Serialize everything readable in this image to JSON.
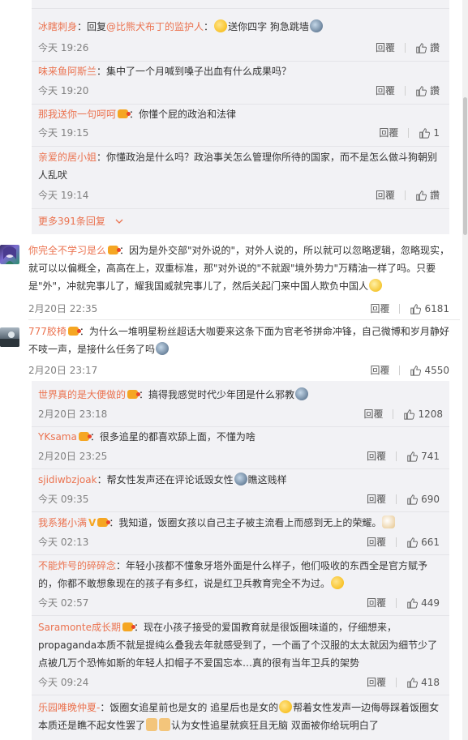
{
  "nested_group_1": {
    "replies": [
      {
        "user": "冰瞎刺身",
        "text_prefix": "：回复",
        "mention": "@比熊犬布丁的监护人",
        "text_after": "：",
        "text_rest": "送你四字 狗急跳墙",
        "time": "今天 19:26",
        "reply_label": "回覆",
        "like_label": "讚"
      },
      {
        "user": "味来鱼阿斯兰",
        "text": "：集中了一个月喊到嗓子出血有什么成果吗？",
        "time": "今天 19:20",
        "reply_label": "回覆",
        "like_label": "讚"
      },
      {
        "user": "那我送你一句呵呵",
        "text": "：你懂个屁的政治和法律",
        "time": "今天 19:15",
        "reply_label": "回覆",
        "like_count": "1"
      },
      {
        "user": "亲爱的居小姐",
        "text_line1": "：你懂政治是什么吗？政治事关怎么管理你所待的国家，而不是怎么做斗狗朝别",
        "text_line2": "人乱吠",
        "time": "今天 19:14",
        "reply_label": "回覆",
        "like_label": "讚"
      }
    ],
    "more_label": "更多391条回复",
    "more_icon": "chevron-down-icon"
  },
  "comments": [
    {
      "user": "你完全不学习是么",
      "line1": "：因为是外交部\"对外说的\"，对外人说的，所以就可以忽略逻辑，忽略现实，",
      "line2": "就可以以偏概全，高高在上，双重标准，那\"对外说的\"不就跟\"境外势力\"万精油一样了吗。只要",
      "line3": "是\"外\"，冲就完事儿了，耀我国威就完事儿了，然后关起门来中国人欺负中国人",
      "time": "2月20日 22:35",
      "reply_label": "回覆",
      "like_count": "6181"
    },
    {
      "user": "777胶椅",
      "line1": "：为什么一堆明星粉丝超话大咖要来这条下面为官老爷拼命冲锋，自己微博和岁月静好",
      "line2": "不吱一声，是接什么任务了吗",
      "time": "2月20日 23:17",
      "reply_label": "回覆",
      "like_count": "4550"
    }
  ],
  "nested_group_2": {
    "replies": [
      {
        "user": "世界真的是大便做的",
        "text": "：搞得我感觉时代少年团是什么邪教",
        "time": "2月20日 23:18",
        "reply_label": "回覆",
        "like_count": "1208"
      },
      {
        "user": "YKsama",
        "text": "：很多追星的都喜欢舔上面，不懂为啥",
        "time": "2月20日 23:25",
        "reply_label": "回覆",
        "like_count": "741"
      },
      {
        "user": "sjidiwbzjoak",
        "text_a": "：帮女性发声还在评论诋毁女性",
        "text_b": "瞧这贱样",
        "time": "今天 09:35",
        "reply_label": "回覆",
        "like_count": "690"
      },
      {
        "user": "我系猪小满",
        "text": "：我知道，饭圈女孩以自己主子被主流看上而感到无上的荣耀。",
        "time": "今天 02:13",
        "reply_label": "回覆",
        "like_count": "661"
      },
      {
        "user": "不能炸号的碎碎念",
        "line1": "：年轻小孩都不懂象牙塔外面是什么样子，他们吸收的东西全是官方赋予",
        "line2": "的，你都不敢想象现在的孩子有多红，说是红卫兵教育完全不为过。",
        "time": "今天 02:57",
        "reply_label": "回覆",
        "like_count": "449"
      },
      {
        "user": "Saramonte成长期",
        "line1": "：现在小孩子接受的爱国教育就是很饭圈味道的，仔细想来，",
        "line2": "propaganda本质不就是提纯么叠我去年就感受到了，一个画了个汉服的太太就因为细节少了",
        "line3": "点被几万个恐怖如斯的年轻人扣帽子不爱国忘本…真的很有当年卫兵的架势",
        "time": "今天 09:24",
        "reply_label": "回覆",
        "like_count": "418"
      },
      {
        "user": "乐园唯晚仲夏-",
        "line1a": "：饭圈女追星前也是女的 追星后也是女的",
        "line1b": "帮着女性发声一边侮辱踩着饭圈女",
        "line2a": "本质还是瞧不起女性罢了",
        "line2b": "认为女性追星就疯狂且无脑 双面被你给玩明白了"
      }
    ]
  }
}
